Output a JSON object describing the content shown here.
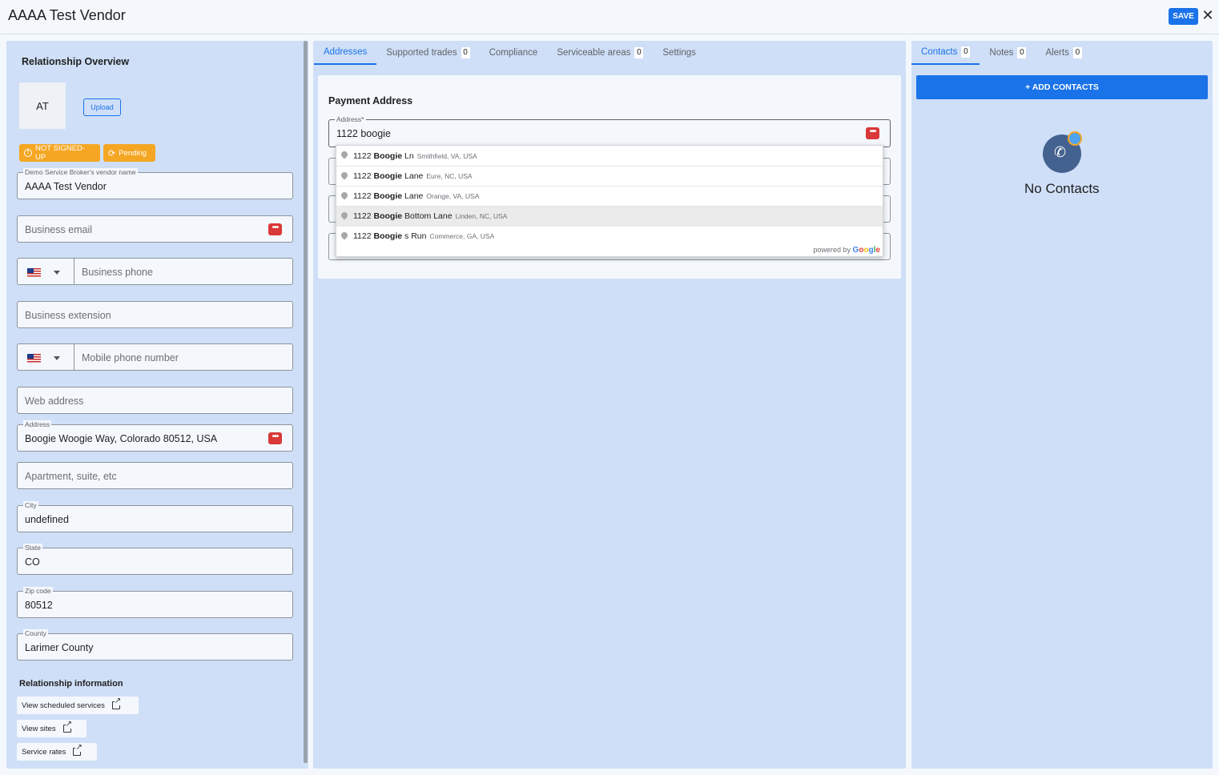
{
  "header": {
    "title": "AAAA Test Vendor",
    "save_label": "SAVE",
    "close_label": "✕"
  },
  "left": {
    "section_title": "Relationship Overview",
    "avatar_initials": "AT",
    "upload_label": "Upload",
    "badges": {
      "signup": "NOT SIGNED-UP",
      "pending": "Pending"
    },
    "fields": {
      "vendor_name": {
        "label": "Demo Service Broker's vendor name",
        "value": "AAAA Test Vendor"
      },
      "business_email": {
        "placeholder": "Business email"
      },
      "business_phone": {
        "placeholder": "Business phone"
      },
      "business_extension": {
        "placeholder": "Business extension"
      },
      "mobile_phone": {
        "placeholder": "Mobile phone number"
      },
      "web_address": {
        "placeholder": "Web address"
      },
      "address": {
        "label": "Address",
        "value": "Boogie Woogie Way, Colorado 80512, USA"
      },
      "apartment": {
        "placeholder": "Apartment, suite, etc"
      },
      "city": {
        "label": "City",
        "value": "undefined"
      },
      "state": {
        "label": "State",
        "value": "CO"
      },
      "zip": {
        "label": "Zip code",
        "value": "80512"
      },
      "county": {
        "label": "County",
        "value": "Larimer County"
      }
    },
    "relationship_title": "Relationship information",
    "links": [
      "View scheduled services",
      "View sites",
      "Service rates"
    ]
  },
  "middle": {
    "tabs": [
      {
        "label": "Addresses",
        "count": ""
      },
      {
        "label": "Supported trades",
        "count": "0"
      },
      {
        "label": "Compliance",
        "count": ""
      },
      {
        "label": "Serviceable areas",
        "count": "0"
      },
      {
        "label": "Settings",
        "count": ""
      }
    ],
    "card_title": "Payment Address",
    "address_field": {
      "label": "Address*",
      "value": "1122 boogie"
    },
    "suggestions": [
      {
        "prefix": "1122 ",
        "match": "Boogie",
        "rest": " Ln",
        "sub": "Smithfield, VA, USA"
      },
      {
        "prefix": "1122 ",
        "match": "Boogie",
        "rest": " Lane",
        "sub": "Eure, NC, USA"
      },
      {
        "prefix": "1122 ",
        "match": "Boogie",
        "rest": " Lane",
        "sub": "Orange, VA, USA"
      },
      {
        "prefix": "1122 ",
        "match": "Boogie",
        "rest": " Bottom Lane",
        "sub": "Linden, NC, USA"
      },
      {
        "prefix": "1122 ",
        "match": "Boogie",
        "rest": "s Run",
        "sub": "Commerce, GA, USA"
      }
    ],
    "powered_by": "powered by",
    "google": "Google"
  },
  "right": {
    "tabs": [
      {
        "label": "Contacts",
        "count": "0"
      },
      {
        "label": "Notes",
        "count": "0"
      },
      {
        "label": "Alerts",
        "count": "0"
      }
    ],
    "add_contacts_label": "+ ADD CONTACTS",
    "empty_text": "No Contacts"
  },
  "colors": {
    "accent": "#1a73e8",
    "panel": "#cfdff7",
    "warning": "#f5a623",
    "danger": "#d93838"
  }
}
